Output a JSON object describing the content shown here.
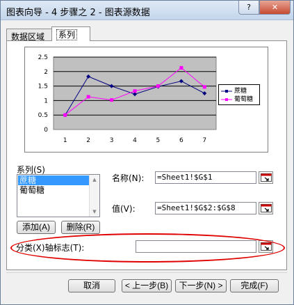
{
  "window": {
    "title": "图表向导 - 4 步骤之 2 - 图表源数据",
    "help_label": "?",
    "close_label": "✕"
  },
  "tabs": [
    {
      "label": "数据区域"
    },
    {
      "label": "系列"
    }
  ],
  "chart_data": {
    "type": "line",
    "x": [
      1,
      2,
      3,
      4,
      5,
      6,
      7
    ],
    "categories": [
      "1",
      "2",
      "3",
      "4",
      "5",
      "6",
      "7"
    ],
    "series": [
      {
        "name": "蔗糖",
        "values": [
          0.5,
          1.83,
          1.5,
          1.22,
          1.48,
          1.67,
          1.25
        ],
        "color": "#000080"
      },
      {
        "name": "葡萄糖",
        "values": [
          0.5,
          1.13,
          1.02,
          1.33,
          1.5,
          2.13,
          1.47
        ],
        "color": "#ff00ff"
      }
    ],
    "y_ticks": [
      "0",
      "0.5",
      "1",
      "1.5",
      "2",
      "2.5"
    ],
    "ylim": [
      0,
      2.5
    ],
    "grid": true,
    "plot_background": "#c0c0c0",
    "legend_position": "right"
  },
  "series_panel": {
    "label": "系列(S)",
    "items": [
      {
        "label": "蔗糖",
        "selected": true
      },
      {
        "label": "葡萄糖",
        "selected": false
      }
    ],
    "add_label": "添加(A)",
    "remove_label": "删除(R)"
  },
  "fields": {
    "name_label": "名称(N):",
    "name_value": "=Sheet1!$G$1",
    "value_label": "值(V):",
    "value_value": "=Sheet1!$G$2:$G$8",
    "category_label": "分类(X)轴标志(T):",
    "category_value": ""
  },
  "footer": {
    "cancel_label": "取消",
    "back_label": "< 上一步(B)",
    "next_label": "下一步(N) >",
    "finish_label": "完成(F)"
  },
  "colors": {
    "highlight": "#e00000",
    "selection": "#3399ff"
  }
}
